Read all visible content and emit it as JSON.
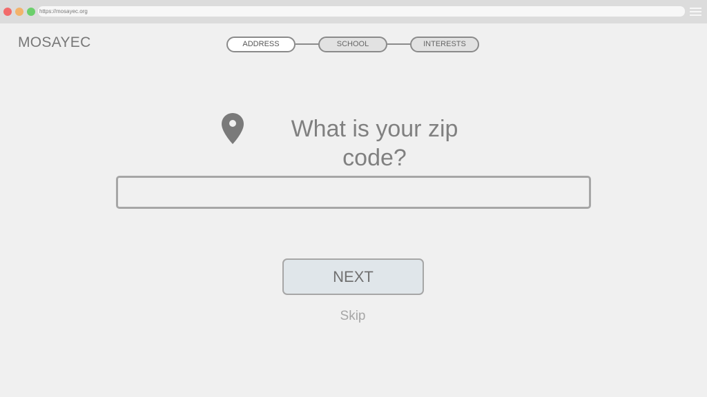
{
  "browser": {
    "url": "https://mosayec.org"
  },
  "header": {
    "logo": "MOSAYEC"
  },
  "stepper": {
    "steps": [
      {
        "label": "ADDRESS",
        "state": "active"
      },
      {
        "label": "SCHOOL",
        "state": "inactive"
      },
      {
        "label": "INTERESTS",
        "state": "inactive"
      }
    ]
  },
  "question": {
    "icon": "map-pin-icon",
    "text": "What is your zip code?"
  },
  "zip_input": {
    "value": "",
    "placeholder": ""
  },
  "actions": {
    "next_label": "NEXT",
    "skip_label": "Skip"
  },
  "colors": {
    "background": "#f0f0f0",
    "text_muted": "#808080",
    "button_fill": "#e0e6ea",
    "border": "#a6a6a6"
  }
}
